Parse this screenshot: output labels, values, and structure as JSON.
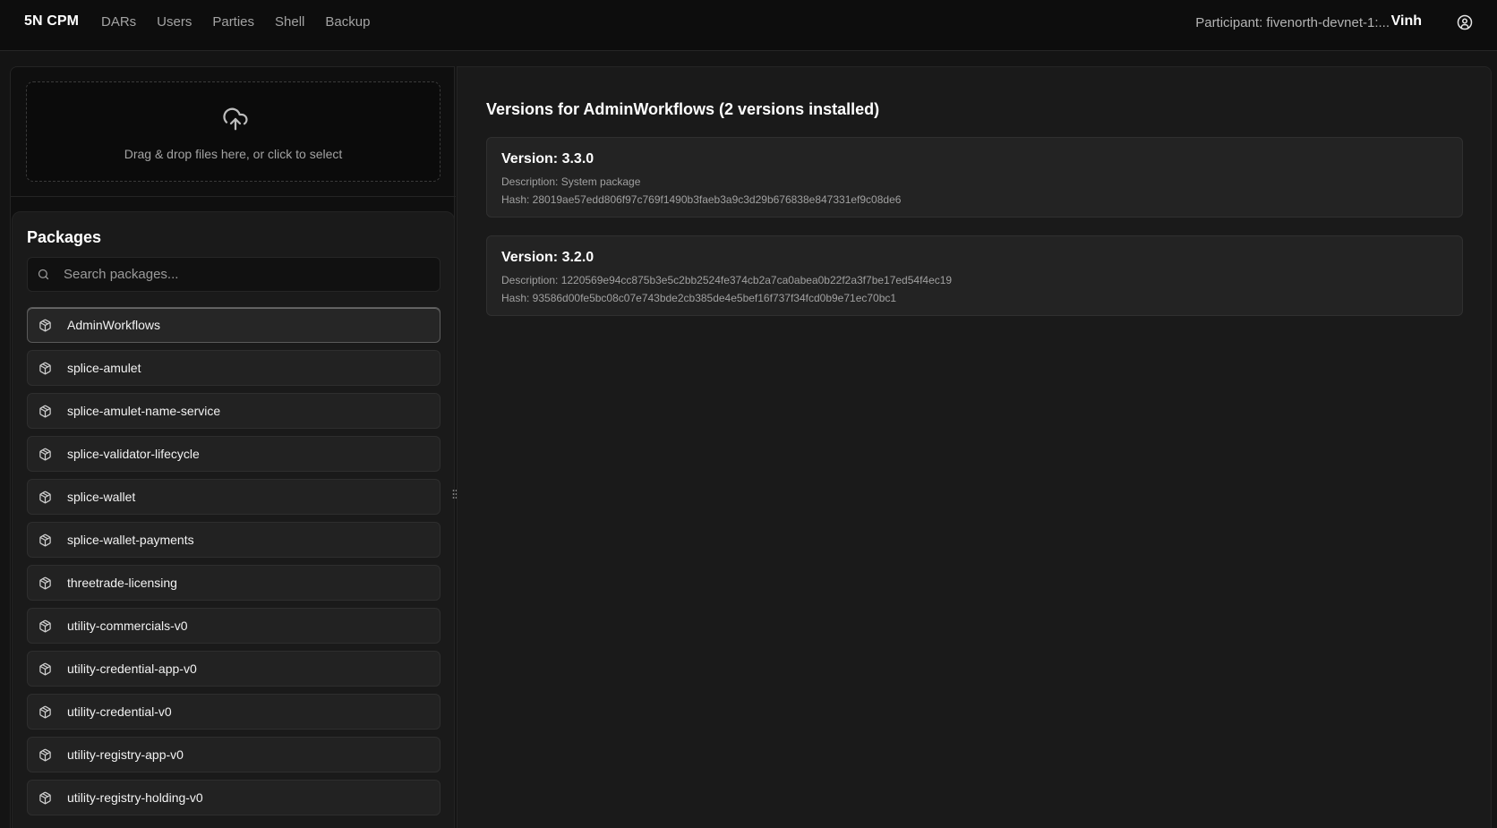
{
  "header": {
    "brand": "5N CPM",
    "nav": [
      "DARs",
      "Users",
      "Parties",
      "Shell",
      "Backup"
    ],
    "participant": "Participant: fivenorth-devnet-1:...",
    "username": "Vinh",
    "user_icon": "user-circle-icon"
  },
  "dropzone": {
    "text": "Drag & drop files here, or click to select",
    "icon": "cloud-upload-icon"
  },
  "packages": {
    "title": "Packages",
    "search_placeholder": "Search packages...",
    "items": [
      "AdminWorkflows",
      "splice-amulet",
      "splice-amulet-name-service",
      "splice-validator-lifecycle",
      "splice-wallet",
      "splice-wallet-payments",
      "threetrade-licensing",
      "utility-commercials-v0",
      "utility-credential-app-v0",
      "utility-credential-v0",
      "utility-registry-app-v0",
      "utility-registry-holding-v0"
    ],
    "selected": "AdminWorkflows"
  },
  "versions": {
    "title": "Versions for AdminWorkflows (2 versions installed)",
    "list": [
      {
        "title": "Version: 3.3.0",
        "description": "Description: System package",
        "hash": "Hash: 28019ae57edd806f97c769f1490b3faeb3a9c3d29b676838e847331ef9c08de6"
      },
      {
        "title": "Version: 3.2.0",
        "description": "Description: 1220569e94cc875b3e5c2bb2524fe374cb2a7ca0abea0b22f2a3f7be17ed54f4ec19",
        "hash": "Hash: 93586d00fe5bc08c07e743bde2cb385de4e5bef16f737f34fcd0b9e71ec70bc1"
      }
    ]
  }
}
